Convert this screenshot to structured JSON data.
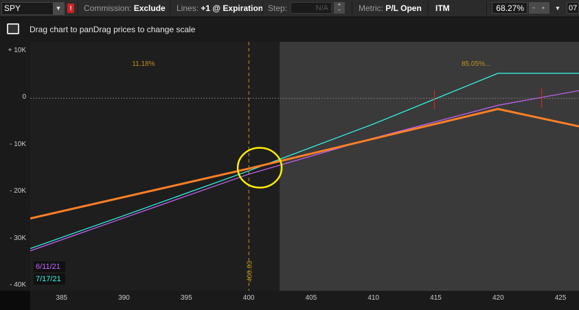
{
  "toolbar": {
    "symbol": "SPY",
    "commission_label": "Commission:",
    "commission_value": "Exclude",
    "lines_label": "Lines:",
    "lines_value": "+1 @ Expiration",
    "step_label": "Step:",
    "step_value": "N/A",
    "metric_label": "Metric:",
    "metric_value": "P/L Open",
    "itm_label": "ITM",
    "itm_percent": "68.27%",
    "overflow_label": "07"
  },
  "hint_text": "Drag chart to panDrag prices to change scale",
  "chart_data": {
    "type": "line",
    "x_ticks": [
      "385",
      "390",
      "395",
      "400",
      "405",
      "410",
      "415",
      "420",
      "425"
    ],
    "y_ticks": [
      "+ 10K",
      "0",
      "- 10K",
      "- 20K",
      "- 30K",
      "- 40K"
    ],
    "x_range": [
      382.5,
      426.5
    ],
    "y_range": [
      -40000,
      10000
    ],
    "probability_left": "11.18%",
    "probability_right": "85.05%...",
    "cursor_price": "400.03",
    "cursor_x": 400.03,
    "shaded_from_x": 402.5,
    "strike_marks": [
      {
        "x": 414.9,
        "y": -300
      },
      {
        "x": 423.5,
        "y": 0
      }
    ],
    "series": [
      {
        "name": "6/11/21",
        "color": "#cc66ff",
        "x": [
          382.5,
          390,
          400,
          410,
          420,
          426.5
        ],
        "y": [
          -32500,
          -25500,
          -16200,
          -8500,
          -1500,
          1600
        ]
      },
      {
        "name": "7/17/21",
        "color": "#33ffee",
        "x": [
          382.5,
          390,
          400,
          410,
          420,
          426.5
        ],
        "y": [
          -32000,
          -25000,
          -15500,
          -5500,
          5300,
          5300
        ]
      },
      {
        "name": "",
        "color": "#ff7f27",
        "x": [
          382.5,
          400,
          420,
          426.5
        ],
        "y": [
          -25600,
          -15000,
          -2300,
          -6000
        ]
      }
    ],
    "highlight_circle": {
      "x": 400.9,
      "y": -14800
    }
  },
  "colors": {
    "axis": "#1a1a1a",
    "toolbar": "#2b2b2b",
    "accent_label": "#d0a020"
  }
}
